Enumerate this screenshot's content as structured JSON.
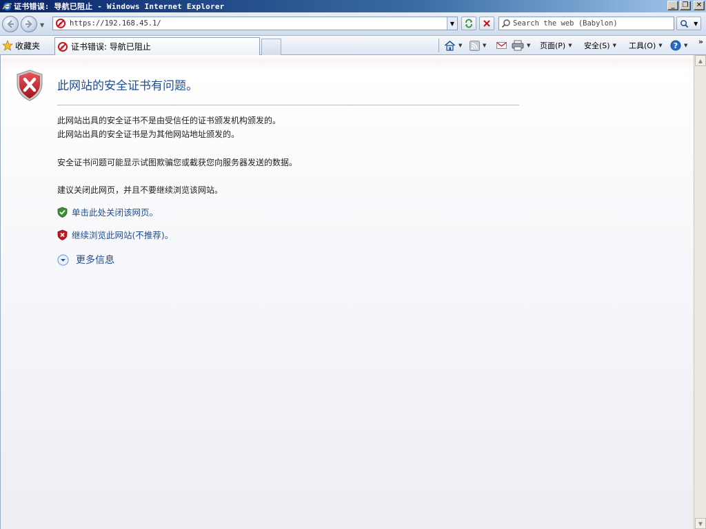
{
  "window": {
    "title": "证书错误: 导航已阻止 - Windows Internet Explorer",
    "controls": {
      "minimize": "_",
      "restore": "❐",
      "close": "✕"
    }
  },
  "address_bar": {
    "url": "https://192.168.45.1/",
    "search_placeholder": "Search the web (Babylon)"
  },
  "command_bar": {
    "favorites_label": "收藏夹",
    "tab_label": "证书错误: 导航已阻止",
    "page_menu": "页面(P)",
    "safety_menu": "安全(S)",
    "tools_menu": "工具(O)",
    "more": "»"
  },
  "content": {
    "heading": "此网站的安全证书有问题。",
    "paragraphs": [
      "此网站出具的安全证书不是由受信任的证书颁发机构颁发的。",
      "此网站出具的安全证书是为其他网站地址颁发的。",
      "安全证书问题可能显示试图欺骗您或截获您向服务器发送的数据。",
      "建议关闭此网页，并且不要继续浏览该网站。"
    ],
    "link_close": "单击此处关闭该网页。",
    "link_continue": "继续浏览此网站(不推荐)。",
    "more_info": "更多信息"
  },
  "icons": {
    "ie_logo": "ie-logo-icon",
    "certificate_error": "certificate-error-icon",
    "shield_error": "shield-error-icon",
    "shield_ok": "shield-ok-icon",
    "expand": "expand-circle-icon"
  },
  "colors": {
    "title_bar_start": "#0a246a",
    "link": "#1f4d8f",
    "error_red": "#c4161c",
    "ok_green": "#3a8f2f"
  }
}
